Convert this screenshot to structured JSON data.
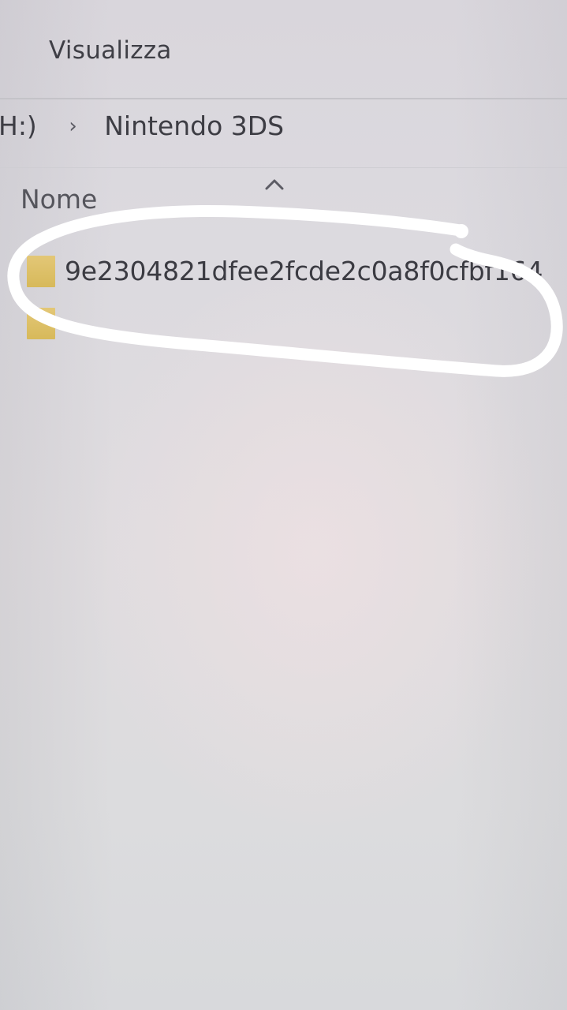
{
  "ribbon": {
    "view_tab": "Visualizza"
  },
  "address_bar": {
    "crumbs": [
      "H:)",
      "Nintendo 3DS"
    ],
    "separator_icon": "chevron-right-icon"
  },
  "file_list": {
    "column_name": "Nome",
    "sort_icon": "chevron-up-icon",
    "rows": [
      {
        "name": "9e2304821dfee2fcde2c0a8f0cfbf164",
        "icon": "folder-icon"
      },
      {
        "name": "",
        "icon": "folder-icon"
      }
    ]
  },
  "colors": {
    "folder": "#dcbf66",
    "annotation_stroke": "#ffffff"
  }
}
